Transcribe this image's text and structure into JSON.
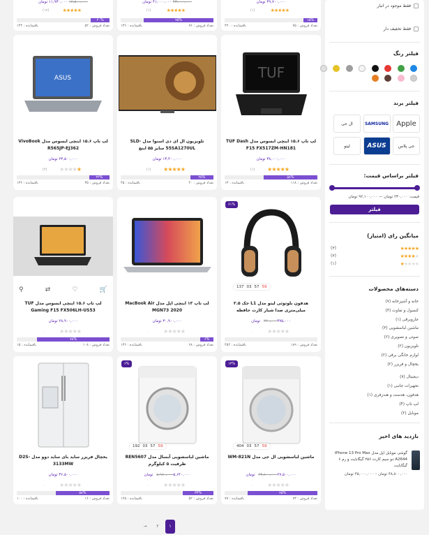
{
  "top_row": [
    {
      "price_new": "۴۹,۷۰۰,۰۰۰ تومان",
      "price_old": "",
      "rating_count": "(۱)",
      "progress_label": "۱۵%",
      "progress": 0.15,
      "sold": "تعداد فروش : ۷۵",
      "remaining": "باقیمانده : ۴۲۰"
    },
    {
      "price_new": "۴۱,۰۰۰,۰۰۰ تومان",
      "price_old": "۴۳,۰۰۰,۰۰۰",
      "rating_count": "(۱)",
      "progress_label": "۷۵%",
      "progress": 0.75,
      "sold": "تعداد فروش : ۷۶",
      "remaining": "باقیمانده : ۱۳۶"
    },
    {
      "price_new": "۱۱,۹۳۰,۰۰۰ تومان",
      "price_old": "۱۲,۵۰۰,۰۰۰",
      "rating_count": "(۱۷)",
      "progress_label": "۲۰%",
      "progress": 0.2,
      "sold": "تعداد فروش : ۵۲",
      "remaining": "باقیمانده : ۱۴۴"
    }
  ],
  "products": [
    {
      "title": "لپ تاپ ۱۵.۶ اینچی ایسوس مدل TUF Dash F15 FX517ZM-HN181",
      "price_old": "",
      "price_new": "۳۸,۰۰۰,۰۰۰ تومان",
      "stars": 5,
      "rating_count": "(۱)",
      "progress_label": "۵۸%",
      "progress": 0.58,
      "sold": "تعداد فروش : ۱۱۸",
      "remaining": "باقیمانده : ۱۳",
      "image": "laptop-dark-icon",
      "badge": "",
      "timer": ""
    },
    {
      "title": "تلویزیون ال ای دی اسنوا مدل SLD-55SA1270UL سایز ۵۵ اینچ",
      "price_old": "",
      "price_new": "۱۳,۴۰۰,۰۰۰ تومان",
      "stars": 5,
      "rating_count": "(۱)",
      "progress_label": "۲۵%",
      "progress": 0.25,
      "sold": "تعداد فروش : ۴۰",
      "remaining": "باقیمانده : ۴۵",
      "image": "tv-lion-icon",
      "badge": "",
      "timer": ""
    },
    {
      "title": "لپ تاپ ۱۵.۶ اینچی ایسوس مدل VivoBook R565JP-EJ362",
      "price_old": "",
      "price_new": "۲۳,۵۰۰,۰۰۰ تومان",
      "stars": 1,
      "rating_count": "(۲)",
      "progress_label": "۲۲%",
      "progress": 0.22,
      "sold": "تعداد فروش : ۳۵",
      "remaining": "باقیمانده : ۱۳۶",
      "image": "laptop-silver-icon",
      "badge": "",
      "timer": ""
    },
    {
      "title": "هدفون بلوتوثی لیتو مدل L1 جک ۳.۵ میلی‌متری صدا شیار کارت حافظه",
      "price_old": "۴۴۰,۰۰۰",
      "price_new": "۳۷۵,۰۰۰ تومان",
      "stars": 0,
      "rating_count": "۰",
      "progress_label": "",
      "progress": 0.0,
      "sold": "تعداد فروش : ۱۸۹",
      "remaining": "باقیمانده : ۴۵۲",
      "image": "headphone-icon",
      "badge": "۶۱%",
      "timer": "59 : 57 : 03 : 137"
    },
    {
      "title": "لپ تاپ ۱۳ اینچی اپل مدل MacBook Air MGN73 2020",
      "price_old": "",
      "price_new": "۳۰,۹۰۰,۰۰۰ تومان",
      "stars": 0,
      "rating_count": "۰",
      "progress_label": "۶%",
      "progress": 0.06,
      "sold": "تعداد فروش : ۶۸",
      "remaining": "باقیمانده : ۱۳۶",
      "image": "macbook-icon",
      "badge": "",
      "timer": ""
    },
    {
      "title": "لپ تاپ ۱۵.۶ اینچی ایسوس مدل TUF Gaming F15 FX506LH-US53",
      "price_old": "",
      "price_new": "۲۸,۹۰۰,۰۰۰ تومان",
      "stars": 0,
      "rating_count": "۰",
      "progress_label": "۷۸%",
      "progress": 0.78,
      "sold": "تعداد فروش : ۱۰۸",
      "remaining": "باقیمانده : ۱۵",
      "image": "laptop-gaming-icon",
      "badge": "",
      "timer": ""
    },
    {
      "title": "ماشین لباسشویی ال جی مدل WM-821N",
      "price_old": "۲۳,۸۰۰,۰۰۰",
      "price_new": "۲۷,۵۰۰,۰۰۰ تومان",
      "stars": 0,
      "rating_count": "۰",
      "progress_label": "۷۵%",
      "progress": 0.75,
      "sold": "تعداد فروش : ۷۳",
      "remaining": "باقیمانده : ۷۷",
      "image": "washer-lg-icon",
      "badge": "۱۳%",
      "timer": "59 : 57 : 03 : 404"
    },
    {
      "title": "ماشین لباسشویی آبسال مدل REN5607 ظرفیت ۵ کیلوگرم",
      "price_old": "۵,۹۸۰,۰۰۰",
      "price_new": "۵,۶۴۰,۰۰۰ تومان",
      "stars": 0,
      "rating_count": "۰",
      "progress_label": "۳۳%",
      "progress": 0.33,
      "sold": "تعداد فروش : ۵۲",
      "remaining": "باقیمانده : ۱۲۵",
      "image": "washer-icon",
      "badge": "۶%",
      "timer": "59 : 57 : 03 : 192"
    },
    {
      "title": "یخچال فریزر ساید بای ساید دوو مدل D2S-3133MW",
      "price_old": "",
      "price_new": "۳۶,۵۰۰,۰۰۰ تومان",
      "stars": 0,
      "rating_count": "۰",
      "progress_label": "۵۸%",
      "progress": 0.58,
      "sold": "تعداد فروش : ۱۶",
      "remaining": "باقیمانده : ۱۰۰",
      "image": "fridge-icon",
      "badge": "",
      "timer": ""
    }
  ],
  "sidebar": {
    "in_stock": "فقط موجود در انبار",
    "discount": "فقط تخفیف دار",
    "color_title": "فیلتر رنگ",
    "colors": [
      "#1e88e5",
      "#43a047",
      "#e53935",
      "#111111",
      "#f5f5f5",
      "#9e9e9e",
      "#e6c229",
      "#e0e0e0",
      "#d0d0d0",
      "#f8bbd0",
      "#5d4037",
      "#e67e22"
    ],
    "brand_title": "فیلتر برند",
    "brands": [
      "Apple",
      "SAMSUNG",
      "ال جی",
      "جی پلاس",
      "ASUS",
      "لیتو"
    ],
    "price_title": "فیلتر براساس قیمت:",
    "price_range": "قیمت: ۲۳۰,۰۰۰ تومان — ۹۲,۱۰۰,۰۰۰ تومان",
    "filter_button": "فیلتر",
    "rating_title": "میانگین رای (امتیاز)",
    "ratings": [
      {
        "stars": 5,
        "count": "(۳)"
      },
      {
        "stars": 4,
        "count": "(۳)"
      },
      {
        "stars": 1,
        "count": "(۱)"
      }
    ],
    "categories_title": "دسته‌های محصولات",
    "categories": [
      "خانه و آشپزخانه (۷)",
      "کنسول و تفاوت (۳)",
      "جاروبرقی (۱)",
      "ماشین لباسشویی (۳)",
      "صوتی و تصویری (۲)",
      "تلویزیون (۲)",
      "لوازم خانگی برقی (۲)",
      "یخچال و فریزر (۲)",
      "دیجیتال (۷)",
      "تجهیزات جانبی (۱)",
      "هدفون، هدست و هندزفری (۱)",
      "لپ تاپ (۴)",
      "موبایل (۲)"
    ],
    "recent_title": "بازدید های اخیر",
    "recent_item": "گوشی موبایل اپل مدل iPhone 13 Pro Max A2644 دو سیم کارت ۲۵۶ گیگابایت و رم ۶ گیگابایت",
    "recent_price": "۴۸,۸۰۰,۰۰۰ تومان – ۴۵,۰۰۰,۰۰۰ تومان"
  },
  "pagination": [
    "۱",
    "۲",
    "→"
  ]
}
